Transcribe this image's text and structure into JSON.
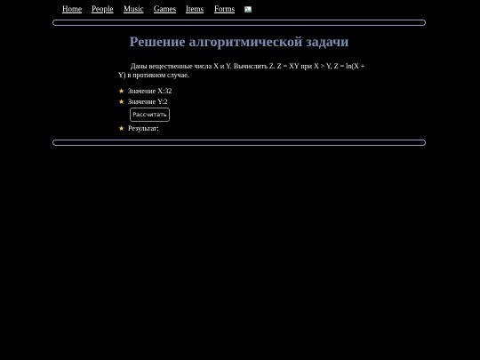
{
  "nav": {
    "items": [
      {
        "label": "Home"
      },
      {
        "label": "People"
      },
      {
        "label": "Music"
      },
      {
        "label": "Games"
      },
      {
        "label": "Items"
      },
      {
        "label": "Forms"
      }
    ],
    "broken_image_icon": "broken-image-icon"
  },
  "main": {
    "title": "Решение алгоритмической задачи",
    "description": "Даны вещественные числа X и Y. Вычислить Z. Z = XY при X > Y, Z = ln(X + Y) в противном случае.",
    "x_label": "Значение X:",
    "x_value": "32",
    "y_label": "Значение Y:",
    "y_value": "2",
    "calculate_button": "Рассчитать",
    "result_label": "Результат:",
    "result_value": ""
  },
  "colors": {
    "background": "#000000",
    "title": "#7b8fb5",
    "bullet_star": "#ffd24d",
    "rule_border": "#8e9dbf"
  },
  "icons": {
    "bullet": "star-icon"
  }
}
